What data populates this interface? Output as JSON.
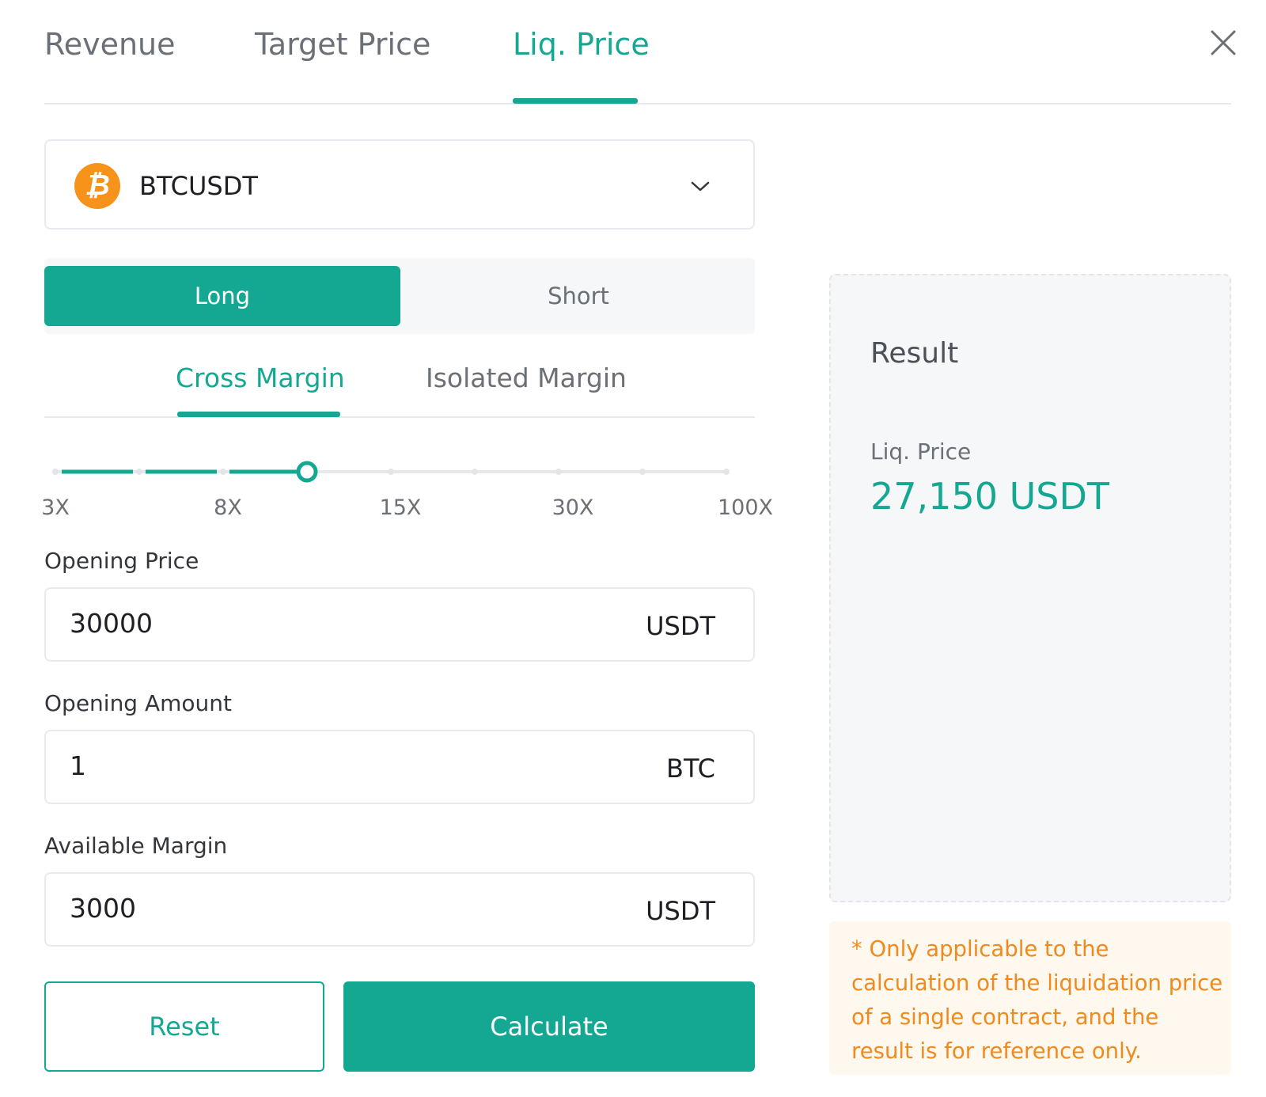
{
  "tabs": [
    {
      "label": "Revenue",
      "active": false
    },
    {
      "label": "Target Price",
      "active": false
    },
    {
      "label": "Liq. Price",
      "active": true
    }
  ],
  "close_icon": "close-icon",
  "pair": {
    "symbol": "BTCUSDT",
    "icon": "bitcoin-icon",
    "glyph": "₿",
    "chevron": "chevron-down-icon"
  },
  "side": {
    "long_label": "Long",
    "short_label": "Short",
    "selected": "Long"
  },
  "margin_mode": {
    "cross_label": "Cross Margin",
    "isolated_label": "Isolated Margin",
    "selected": "Cross Margin"
  },
  "leverage": {
    "tick_labels": [
      "3X",
      "8X",
      "15X",
      "30X",
      "100X"
    ],
    "steps": 9,
    "selected_step": 3
  },
  "fields": {
    "opening_price": {
      "label": "Opening Price",
      "value": "30000",
      "unit": "USDT"
    },
    "opening_amount": {
      "label": "Opening Amount",
      "value": "1",
      "unit": "BTC"
    },
    "available_margin": {
      "label": "Available Margin",
      "value": "3000",
      "unit": "USDT"
    }
  },
  "buttons": {
    "reset": "Reset",
    "calculate": "Calculate"
  },
  "result": {
    "title": "Result",
    "label": "Liq. Price",
    "value": "27,150 USDT"
  },
  "note": "* Only applicable to the calculation of the liquidation price of a single contract, and the result is for reference only.",
  "colors": {
    "accent": "#14a893",
    "note_text": "#f08a1c",
    "note_bg": "#fff8ef"
  }
}
